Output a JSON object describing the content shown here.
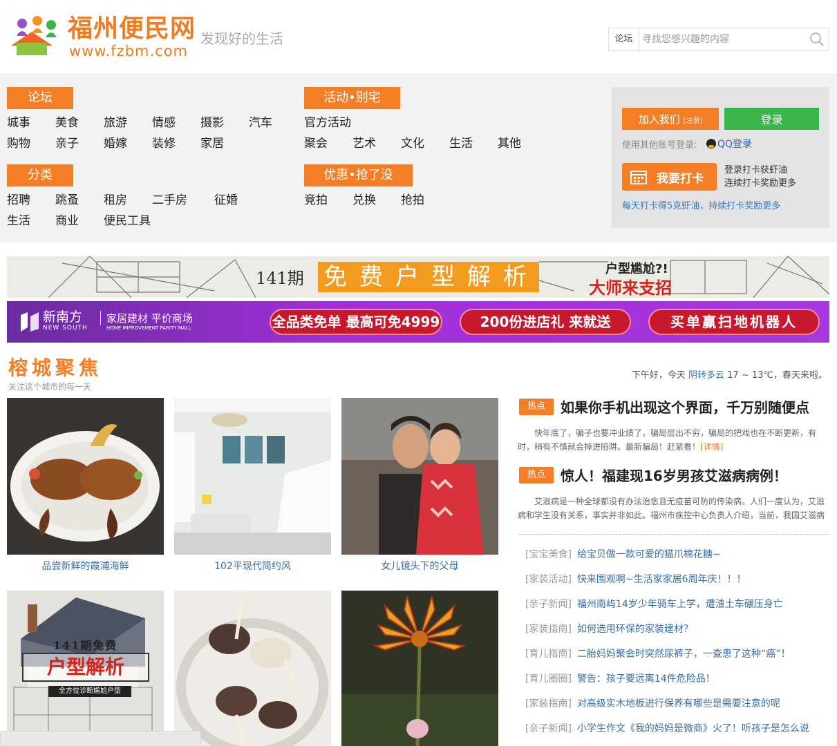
{
  "header": {
    "site_name": "福州便民网",
    "site_url": "www.fzbm.com",
    "slogan": "发现好的生活",
    "search_category": "论坛",
    "search_placeholder": "寻找您感兴趣的内容"
  },
  "nav": {
    "forum": {
      "label": "论坛",
      "links": [
        "城事",
        "美食",
        "旅游",
        "情感",
        "摄影",
        "汽车",
        "购物",
        "亲子",
        "婚嫁",
        "装修",
        "家居"
      ]
    },
    "category": {
      "label": "分类",
      "links": [
        "招聘",
        "跳蚤",
        "租房",
        "二手房",
        "征婚",
        "生活",
        "商业",
        "便民工具"
      ]
    },
    "activity": {
      "label": "活动•别宅",
      "links": [
        "官方活动",
        "聚会",
        "艺术",
        "文化",
        "生活",
        "其他"
      ]
    },
    "deals": {
      "label": "优惠•抢了没",
      "links": [
        "竞拍",
        "兑换",
        "抢拍"
      ]
    }
  },
  "login": {
    "join_label": "加入我们",
    "join_sub": "[注册]",
    "login_label": "登录",
    "other_login": "使用其他账号登录:",
    "qq_login": "QQ登录",
    "checkin_label": "我要打卡",
    "checkin_tip1": "登录打卡获虾油",
    "checkin_tip2": "连续打卡奖励更多",
    "checkin_note": "每天打卡得5克虾油，持续打卡奖励更多"
  },
  "banner1": {
    "issue": "141期",
    "title": "免费户型解析",
    "tag1": "户型尴尬?!",
    "tag2": "大师来支招"
  },
  "banner2": {
    "brand": "新南方",
    "brand_en": "NEW SOUTH",
    "sub": "家居建材 平价商场",
    "sub_en": "HOME IMPROVEMENT PARITY MALL",
    "promos": [
      "全品类免单 最高可免4999",
      "200份进店礼  来就送",
      "买单赢扫地机器人"
    ]
  },
  "section": {
    "title": "榕城聚焦",
    "subtitle": "关注这个城市的每一天",
    "weather_prefix": "下午好，今天",
    "weather_cond": "阴转多云",
    "weather_temp": "17 ~ 13℃",
    "weather_suffix": "，春天来啦。"
  },
  "tiles": [
    {
      "caption": "品尝新鲜的霞浦海鲜"
    },
    {
      "caption": "102平现代简约风"
    },
    {
      "caption": "女儿镜头下的父母"
    },
    {
      "caption": "",
      "overlay_issue": "141期免费",
      "overlay_title": "户型解析",
      "overlay_sub": "全方位诊断尴尬户型"
    },
    {
      "caption": ""
    },
    {
      "caption": ""
    }
  ],
  "hot": [
    {
      "tag": "热点",
      "title": "如果你手机出现这个界面，千万别随便点",
      "desc": "快年底了，骗子也要冲业绩了，骗局层出不穷，骗局的把戏也在不断更新，有时，稍有不慎就会掉进陷阱。最新骗局！赶紧看！",
      "more": "[详情]"
    },
    {
      "tag": "热点",
      "title": "惊人！福建现16岁男孩艾滋病病例！",
      "desc": "艾滋病是一种全球都没有办法治愈且无疫苗可防的传染病。人们一度认为，艾滋病和学生没有关系，事实并非如此。福州市疾控中心负责人介绍，当前，我国艾滋病",
      "more": ""
    }
  ],
  "news": [
    {
      "cat": "[宝宝美食]",
      "title": "给宝贝做一款可爱的猫爪棉花糖~"
    },
    {
      "cat": "[家装活动]",
      "title": "快来围观啊~生活家家居6周年庆！！！"
    },
    {
      "cat": "[亲子新闻]",
      "title": "福州南屿14岁少年骑车上学，遭渣土车碾压身亡"
    },
    {
      "cat": "[家装指南]",
      "title": "如何选用环保的家装建材？"
    },
    {
      "cat": "[育儿指南]",
      "title": "二胎妈妈聚会时突然尿裤子，一查患了这种“癌”！"
    },
    {
      "cat": "[育儿圈圈]",
      "title": "警告：孩子要远离14件危险品！"
    },
    {
      "cat": "[家装指南]",
      "title": "对高级实木地板进行保养有哪些是需要注意的呢"
    },
    {
      "cat": "[亲子新闻]",
      "title": "小学生作文《我的妈妈是微商》火了！听孩子是怎么说"
    }
  ],
  "colors": {
    "accent": "#f37e26",
    "green": "#39b54a",
    "link": "#3a6e9e"
  }
}
